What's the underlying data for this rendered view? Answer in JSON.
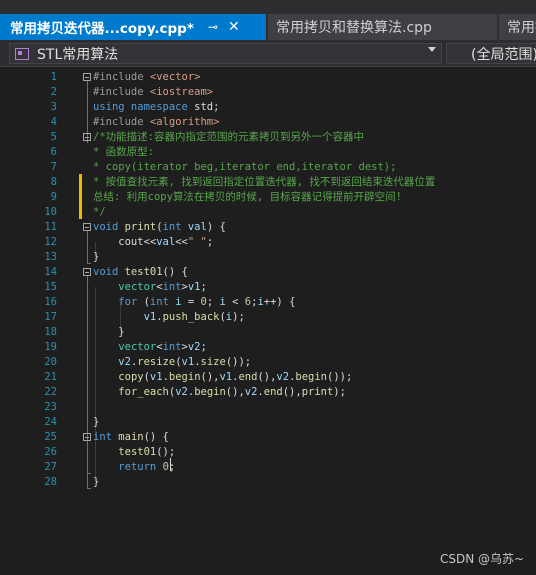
{
  "tabs": {
    "active": {
      "title": "常用拷贝迭代器...copy.cpp*",
      "pin": "⊸",
      "close": "✕"
    },
    "others": [
      {
        "title": "常用拷贝和替换算法.cpp"
      },
      {
        "title": "常用拷"
      }
    ]
  },
  "navbar": {
    "project": "STL常用算法",
    "scope": "(全局范围)"
  },
  "editor": {
    "lines": [
      {
        "n": "1",
        "tokens": [
          [
            "pp",
            "#include "
          ],
          [
            "inc",
            "<vector>"
          ]
        ]
      },
      {
        "n": "2",
        "tokens": [
          [
            "pp",
            "#include "
          ],
          [
            "inc",
            "<iostream>"
          ]
        ]
      },
      {
        "n": "3",
        "tokens": [
          [
            "kw",
            "using namespace "
          ],
          [
            "pl",
            "std;"
          ]
        ]
      },
      {
        "n": "4",
        "tokens": [
          [
            "pp",
            "#include "
          ],
          [
            "inc",
            "<algorithm>"
          ]
        ]
      },
      {
        "n": "5",
        "tokens": [
          [
            "cm",
            "/*功能描述:容器内指定范围的元素拷贝到另外一个容器中"
          ]
        ]
      },
      {
        "n": "6",
        "tokens": [
          [
            "cm",
            "* 函数原型:"
          ]
        ]
      },
      {
        "n": "7",
        "tokens": [
          [
            "cm",
            "* copy(iterator beg,iterator end,iterator dest);"
          ]
        ]
      },
      {
        "n": "8",
        "tokens": [
          [
            "cm",
            "* 按值查找元素, 找到返回指定位置迭代器, 找不到返回结束迭代器位置"
          ]
        ]
      },
      {
        "n": "9",
        "tokens": [
          [
            "cm",
            "总结: 利用copy算法在拷贝的时候, 目标容器记得提前开辟空间!"
          ]
        ]
      },
      {
        "n": "10",
        "tokens": [
          [
            "cm",
            "*/"
          ]
        ]
      },
      {
        "n": "11",
        "tokens": [
          [
            "kw",
            "void "
          ],
          [
            "fn",
            "print"
          ],
          [
            "pl",
            "("
          ],
          [
            "kw",
            "int "
          ],
          [
            "var",
            "val"
          ],
          [
            "pl",
            ") {"
          ]
        ]
      },
      {
        "n": "12",
        "tokens": [
          [
            "pl",
            "    cout<<"
          ],
          [
            "var",
            "val"
          ],
          [
            "pl",
            "<<"
          ],
          [
            "str",
            "\" \""
          ],
          [
            "pl",
            ";"
          ]
        ]
      },
      {
        "n": "13",
        "tokens": [
          [
            "pl",
            "}"
          ]
        ]
      },
      {
        "n": "14",
        "tokens": [
          [
            "kw",
            "void "
          ],
          [
            "fn",
            "test01"
          ],
          [
            "pl",
            "() {"
          ]
        ]
      },
      {
        "n": "15",
        "tokens": [
          [
            "pl",
            "    "
          ],
          [
            "ty",
            "vector"
          ],
          [
            "pl",
            "<"
          ],
          [
            "kw",
            "int"
          ],
          [
            "pl",
            ">"
          ],
          [
            "var",
            "v1"
          ],
          [
            "pl",
            ";"
          ]
        ]
      },
      {
        "n": "16",
        "tokens": [
          [
            "pl",
            "    "
          ],
          [
            "kw",
            "for "
          ],
          [
            "pl",
            "("
          ],
          [
            "kw",
            "int "
          ],
          [
            "var",
            "i"
          ],
          [
            "pl",
            " = "
          ],
          [
            "num",
            "0"
          ],
          [
            "pl",
            "; "
          ],
          [
            "var",
            "i"
          ],
          [
            "pl",
            " < "
          ],
          [
            "num",
            "6"
          ],
          [
            "pl",
            ";"
          ],
          [
            "var",
            "i"
          ],
          [
            "pl",
            "++) {"
          ]
        ]
      },
      {
        "n": "17",
        "tokens": [
          [
            "pl",
            "        "
          ],
          [
            "var",
            "v1"
          ],
          [
            "pl",
            "."
          ],
          [
            "fn",
            "push_back"
          ],
          [
            "pl",
            "("
          ],
          [
            "var",
            "i"
          ],
          [
            "pl",
            ");"
          ]
        ]
      },
      {
        "n": "18",
        "tokens": [
          [
            "pl",
            "    }"
          ]
        ]
      },
      {
        "n": "19",
        "tokens": [
          [
            "pl",
            "    "
          ],
          [
            "ty",
            "vector"
          ],
          [
            "pl",
            "<"
          ],
          [
            "kw",
            "int"
          ],
          [
            "pl",
            ">"
          ],
          [
            "var",
            "v2"
          ],
          [
            "pl",
            ";"
          ]
        ]
      },
      {
        "n": "20",
        "tokens": [
          [
            "pl",
            "    "
          ],
          [
            "var",
            "v2"
          ],
          [
            "pl",
            "."
          ],
          [
            "fn",
            "resize"
          ],
          [
            "pl",
            "("
          ],
          [
            "var",
            "v1"
          ],
          [
            "pl",
            "."
          ],
          [
            "fn",
            "size"
          ],
          [
            "pl",
            "());"
          ]
        ]
      },
      {
        "n": "21",
        "tokens": [
          [
            "pl",
            "    "
          ],
          [
            "fn",
            "copy"
          ],
          [
            "pl",
            "("
          ],
          [
            "var",
            "v1"
          ],
          [
            "pl",
            "."
          ],
          [
            "fn",
            "begin"
          ],
          [
            "pl",
            "(),"
          ],
          [
            "var",
            "v1"
          ],
          [
            "pl",
            "."
          ],
          [
            "fn",
            "end"
          ],
          [
            "pl",
            "(),"
          ],
          [
            "var",
            "v2"
          ],
          [
            "pl",
            "."
          ],
          [
            "fn",
            "begin"
          ],
          [
            "pl",
            "());"
          ]
        ]
      },
      {
        "n": "22",
        "tokens": [
          [
            "pl",
            "    "
          ],
          [
            "fn",
            "for_each"
          ],
          [
            "pl",
            "("
          ],
          [
            "var",
            "v2"
          ],
          [
            "pl",
            "."
          ],
          [
            "fn",
            "begin"
          ],
          [
            "pl",
            "(),"
          ],
          [
            "var",
            "v2"
          ],
          [
            "pl",
            "."
          ],
          [
            "fn",
            "end"
          ],
          [
            "pl",
            "(),"
          ],
          [
            "fn",
            "print"
          ],
          [
            "pl",
            ");"
          ]
        ]
      },
      {
        "n": "23",
        "tokens": []
      },
      {
        "n": "24",
        "tokens": [
          [
            "pl",
            "}"
          ]
        ]
      },
      {
        "n": "25",
        "tokens": [
          [
            "kw",
            "int "
          ],
          [
            "fn",
            "main"
          ],
          [
            "pl",
            "() {"
          ]
        ]
      },
      {
        "n": "26",
        "tokens": [
          [
            "pl",
            "    "
          ],
          [
            "fn",
            "test01"
          ],
          [
            "pl",
            "();"
          ]
        ]
      },
      {
        "n": "27",
        "tokens": [
          [
            "pl",
            "    "
          ],
          [
            "kw",
            "return "
          ],
          [
            "num",
            "0"
          ],
          [
            "pl",
            ";"
          ]
        ]
      },
      {
        "n": "28",
        "tokens": [
          [
            "pl",
            "}"
          ]
        ]
      }
    ]
  },
  "watermark": "CSDN @乌苏~",
  "colors": {
    "accent": "#007acc",
    "keyword": "#569cd6",
    "comment": "#57a64a",
    "function": "#dcdcaa",
    "type": "#4ec9b0",
    "variable": "#9cdcfe",
    "string": "#d69d85",
    "line_number": "#2b91af"
  }
}
